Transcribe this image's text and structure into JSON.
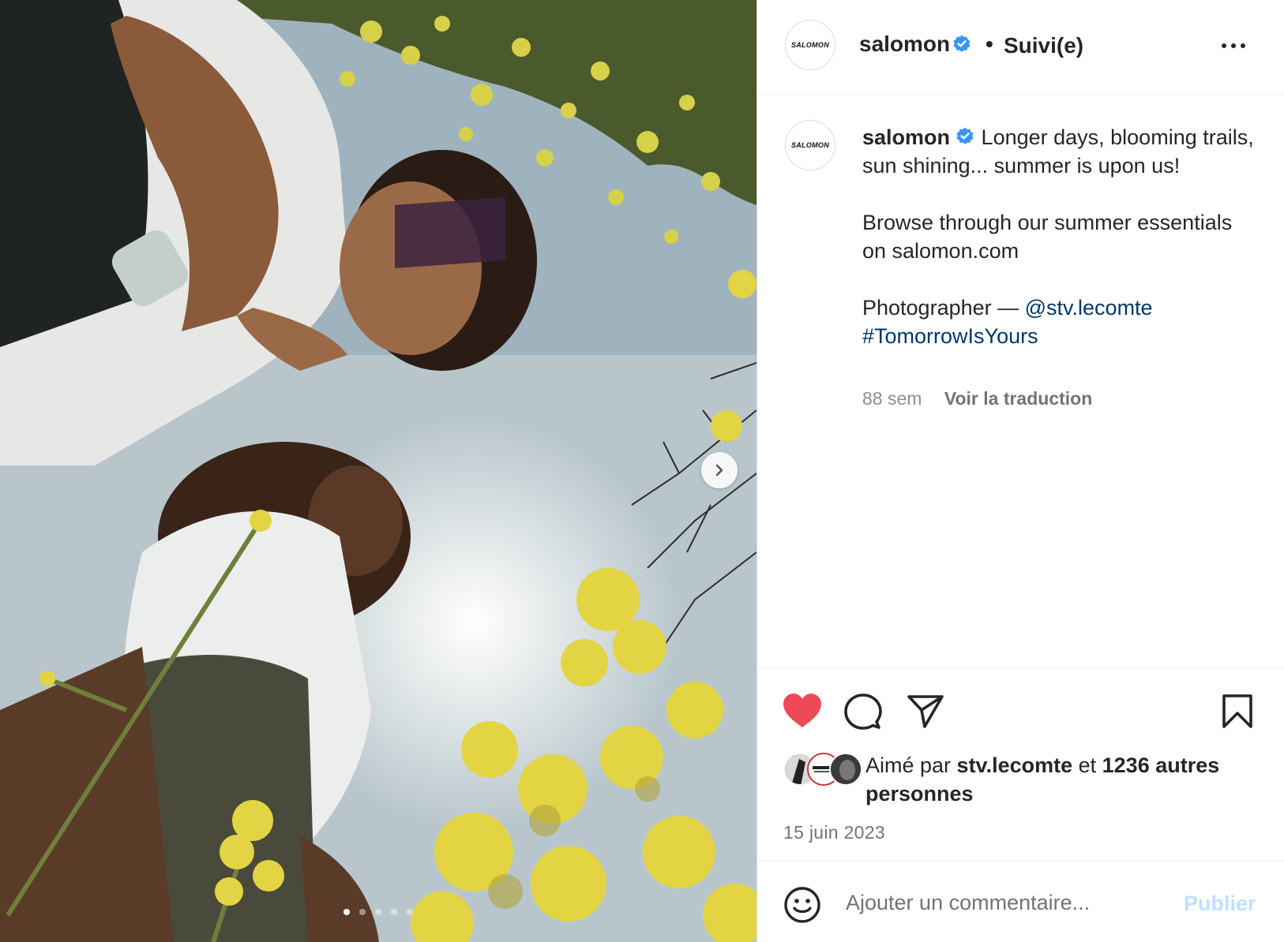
{
  "post": {
    "author": "salomon",
    "avatar_text": "SALOMON",
    "follow_status": "Suivi(e)",
    "separator": "•",
    "caption": {
      "author": "salomon",
      "line1": "Longer days, blooming trails, sun shining... summer is upon us!",
      "line2": "Browse through our summer essentials on salomon.com",
      "photographer_label": "Photographer — ",
      "photographer_handle": "@stv.lecomte",
      "hashtag": "#TomorrowIsYours"
    },
    "age": "88 sem",
    "translate_label": "Voir la traduction",
    "likes": {
      "prefix": "Aimé par ",
      "first_liker": "stv.lecomte",
      "conjunction": " et ",
      "others": "1236 autres personnes"
    },
    "date": "15 juin 2023",
    "liked": true
  },
  "comment_box": {
    "placeholder": "Ajouter un commentaire...",
    "publish_label": "Publier"
  },
  "carousel": {
    "total": 5,
    "current": 1
  },
  "icons": {
    "verified": "verified-badge-icon",
    "more": "more-options-icon",
    "like": "heart-icon",
    "comment": "comment-icon",
    "share": "paper-plane-icon",
    "save": "bookmark-icon",
    "emoji": "emoji-icon",
    "next": "chevron-right-icon"
  },
  "colors": {
    "verified": "#3897f0",
    "liked_heart": "#ed4956",
    "link": "#00376b",
    "publish_disabled": "#c0dffd",
    "secondary_text": "#737373"
  }
}
